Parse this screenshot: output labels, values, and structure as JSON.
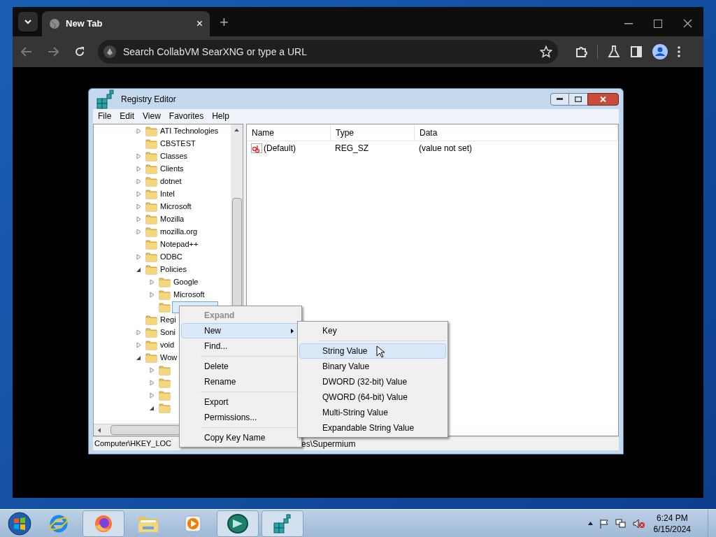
{
  "browser": {
    "tab": {
      "title": "New Tab",
      "close": "×"
    },
    "new_tab": "+",
    "address": {
      "placeholder": "Search CollabVM SearXNG or type a URL"
    }
  },
  "regedit": {
    "title": "Registry Editor",
    "menu": [
      "File",
      "Edit",
      "View",
      "Favorites",
      "Help"
    ],
    "tree": [
      {
        "label": "ATI Technologies",
        "kind": "collapsed"
      },
      {
        "label": "CBSTEST",
        "kind": "leaf"
      },
      {
        "label": "Classes",
        "kind": "collapsed"
      },
      {
        "label": "Clients",
        "kind": "collapsed"
      },
      {
        "label": "dotnet",
        "kind": "collapsed"
      },
      {
        "label": "Intel",
        "kind": "collapsed"
      },
      {
        "label": "Microsoft",
        "kind": "collapsed"
      },
      {
        "label": "Mozilla",
        "kind": "collapsed"
      },
      {
        "label": "mozilla.org",
        "kind": "collapsed"
      },
      {
        "label": "Notepad++",
        "kind": "leaf"
      },
      {
        "label": "ODBC",
        "kind": "collapsed"
      },
      {
        "label": "Policies",
        "kind": "expanded",
        "children": [
          {
            "label": "Google",
            "kind": "collapsed",
            "selected": false
          },
          {
            "label": "Microsoft",
            "kind": "collapsed",
            "selected": false
          },
          {
            "kind": "leaf",
            "selected": true
          }
        ]
      },
      {
        "label": "Regi",
        "kind": "leaf"
      },
      {
        "label": "Soni",
        "kind": "collapsed"
      },
      {
        "label": "void",
        "kind": "collapsed"
      },
      {
        "label": "Wow",
        "kind": "expanded",
        "children": [
          {
            "kind": "collapsed"
          },
          {
            "kind": "collapsed"
          },
          {
            "kind": "collapsed"
          },
          {
            "kind": "expanded"
          }
        ]
      }
    ],
    "columns": [
      "Name",
      "Type",
      "Data"
    ],
    "rows": [
      {
        "name": "(Default)",
        "type": "REG_SZ",
        "data": "(value not set)"
      }
    ],
    "status_bar": [
      "Computer\\HKEY_LOC",
      "es\\Supermium"
    ]
  },
  "context_menu": [
    {
      "kind": "item",
      "label": "Expand",
      "default": true,
      "disabled": true,
      "selected": false
    },
    {
      "kind": "item",
      "label": "New",
      "default": false,
      "disabled": false,
      "selected": true,
      "submenu": true
    },
    {
      "kind": "item",
      "label": "Find...",
      "default": false,
      "disabled": false,
      "selected": false
    },
    {
      "kind": "separator"
    },
    {
      "kind": "item",
      "label": "Delete",
      "default": false,
      "disabled": false,
      "selected": false
    },
    {
      "kind": "item",
      "label": "Rename",
      "default": false,
      "disabled": false,
      "selected": false
    },
    {
      "kind": "separator"
    },
    {
      "kind": "item",
      "label": "Export",
      "default": false,
      "disabled": false,
      "selected": false
    },
    {
      "kind": "item",
      "label": "Permissions...",
      "default": false,
      "disabled": false,
      "selected": false
    },
    {
      "kind": "separator"
    },
    {
      "kind": "item",
      "label": "Copy Key Name",
      "default": false,
      "disabled": false,
      "selected": false
    }
  ],
  "submenu": [
    {
      "kind": "item",
      "label": "Key",
      "selected": false
    },
    {
      "kind": "separator"
    },
    {
      "kind": "item",
      "label": "String Value",
      "selected": true
    },
    {
      "kind": "item",
      "label": "Binary Value",
      "selected": false
    },
    {
      "kind": "item",
      "label": "DWORD (32-bit) Value",
      "selected": false
    },
    {
      "kind": "item",
      "label": "QWORD (64-bit) Value",
      "selected": false
    },
    {
      "kind": "item",
      "label": "Multi-String Value",
      "selected": false
    },
    {
      "kind": "item",
      "label": "Expandable String Value",
      "selected": false
    }
  ],
  "taskbar": {
    "apps": [
      {
        "kind": "ie",
        "open": false
      },
      {
        "kind": "fox",
        "open": true
      },
      {
        "kind": "folder",
        "open": false
      },
      {
        "kind": "media",
        "open": false
      },
      {
        "kind": "orb",
        "open": true
      },
      {
        "kind": "cubes",
        "open": true
      }
    ],
    "clock": {
      "time": "6:24 PM",
      "date": "6/15/2024"
    }
  }
}
